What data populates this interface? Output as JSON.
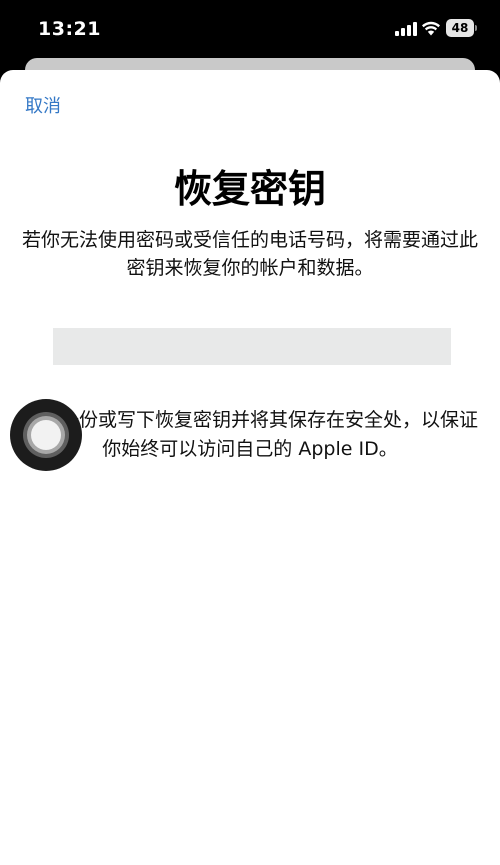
{
  "status_bar": {
    "time": "13:21",
    "battery_level": "48",
    "icons": [
      "cellular-signal-icon",
      "wifi-icon",
      "battery-icon"
    ]
  },
  "sheet": {
    "cancel_label": "取消",
    "title": "恢复密钥",
    "description": "若你无法使用密码或受信任的电话号码，将需要通过此密钥来恢复你的帐户和数据。",
    "key_value": "",
    "instruction": "打印一份或写下恢复密钥并将其保存在安全处，以保证你始终可以访问自己的 Apple ID。"
  },
  "colors": {
    "link": "#3478c6",
    "placeholder_bg": "#e8e9e9",
    "status_bar_bg": "#000000"
  }
}
